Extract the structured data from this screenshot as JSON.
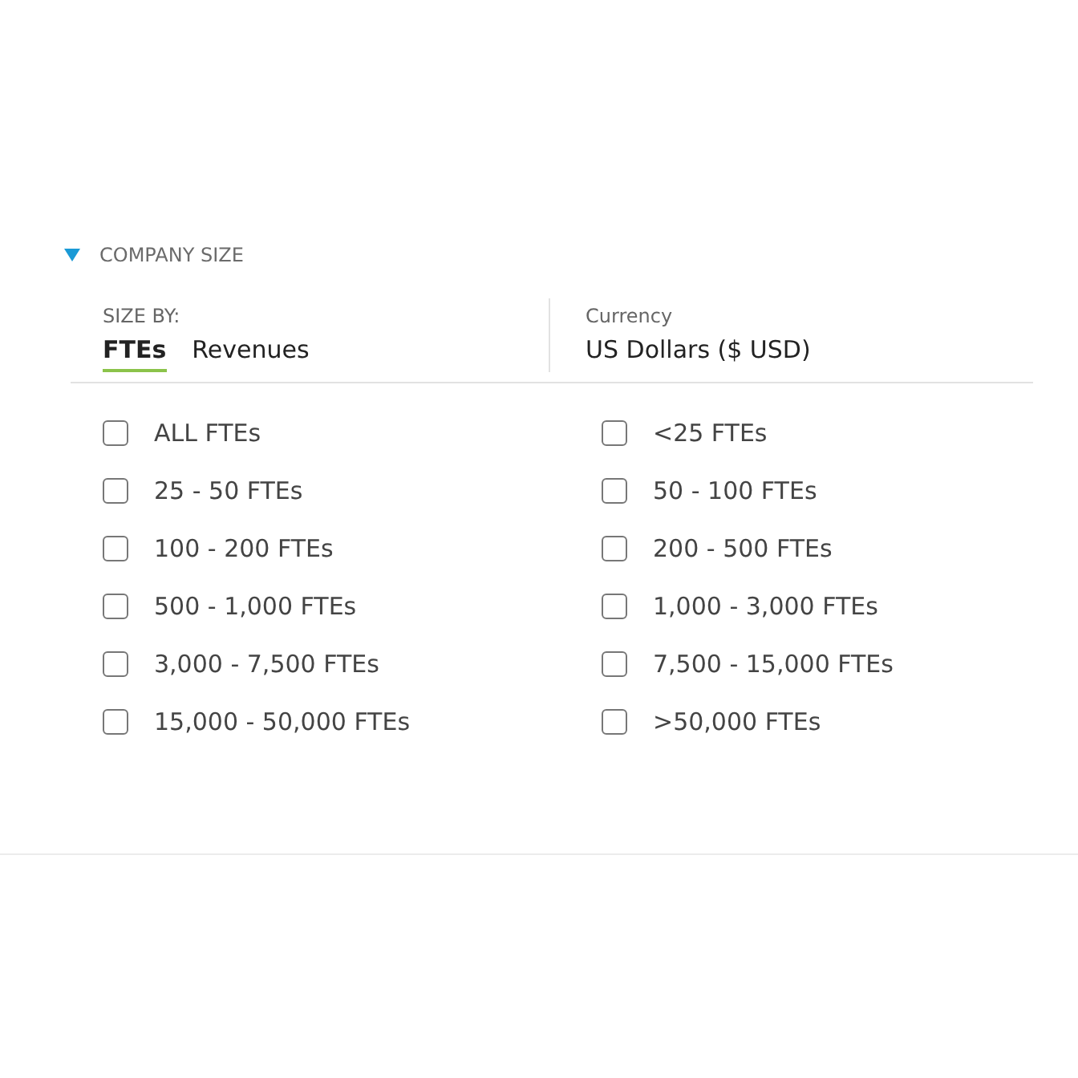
{
  "section": {
    "title": "COMPANY SIZE",
    "expanded": true
  },
  "size_by": {
    "label": "SIZE BY:",
    "tabs": [
      {
        "label": "FTEs",
        "selected": true
      },
      {
        "label": "Revenues",
        "selected": false
      }
    ]
  },
  "currency": {
    "label": "Currency",
    "value": "US Dollars ($ USD)"
  },
  "options": [
    {
      "label": "ALL FTEs",
      "checked": false
    },
    {
      "label": "<25 FTEs",
      "checked": false
    },
    {
      "label": "25 - 50 FTEs",
      "checked": false
    },
    {
      "label": "50 - 100 FTEs",
      "checked": false
    },
    {
      "label": "100 - 200 FTEs",
      "checked": false
    },
    {
      "label": "200 - 500 FTEs",
      "checked": false
    },
    {
      "label": "500 - 1,000 FTEs",
      "checked": false
    },
    {
      "label": "1,000 - 3,000 FTEs",
      "checked": false
    },
    {
      "label": "3,000 - 7,500 FTEs",
      "checked": false
    },
    {
      "label": "7,500 - 15,000 FTEs",
      "checked": false
    },
    {
      "label": "15,000 - 50,000 FTEs",
      "checked": false
    },
    {
      "label": ">50,000 FTEs",
      "checked": false
    }
  ]
}
